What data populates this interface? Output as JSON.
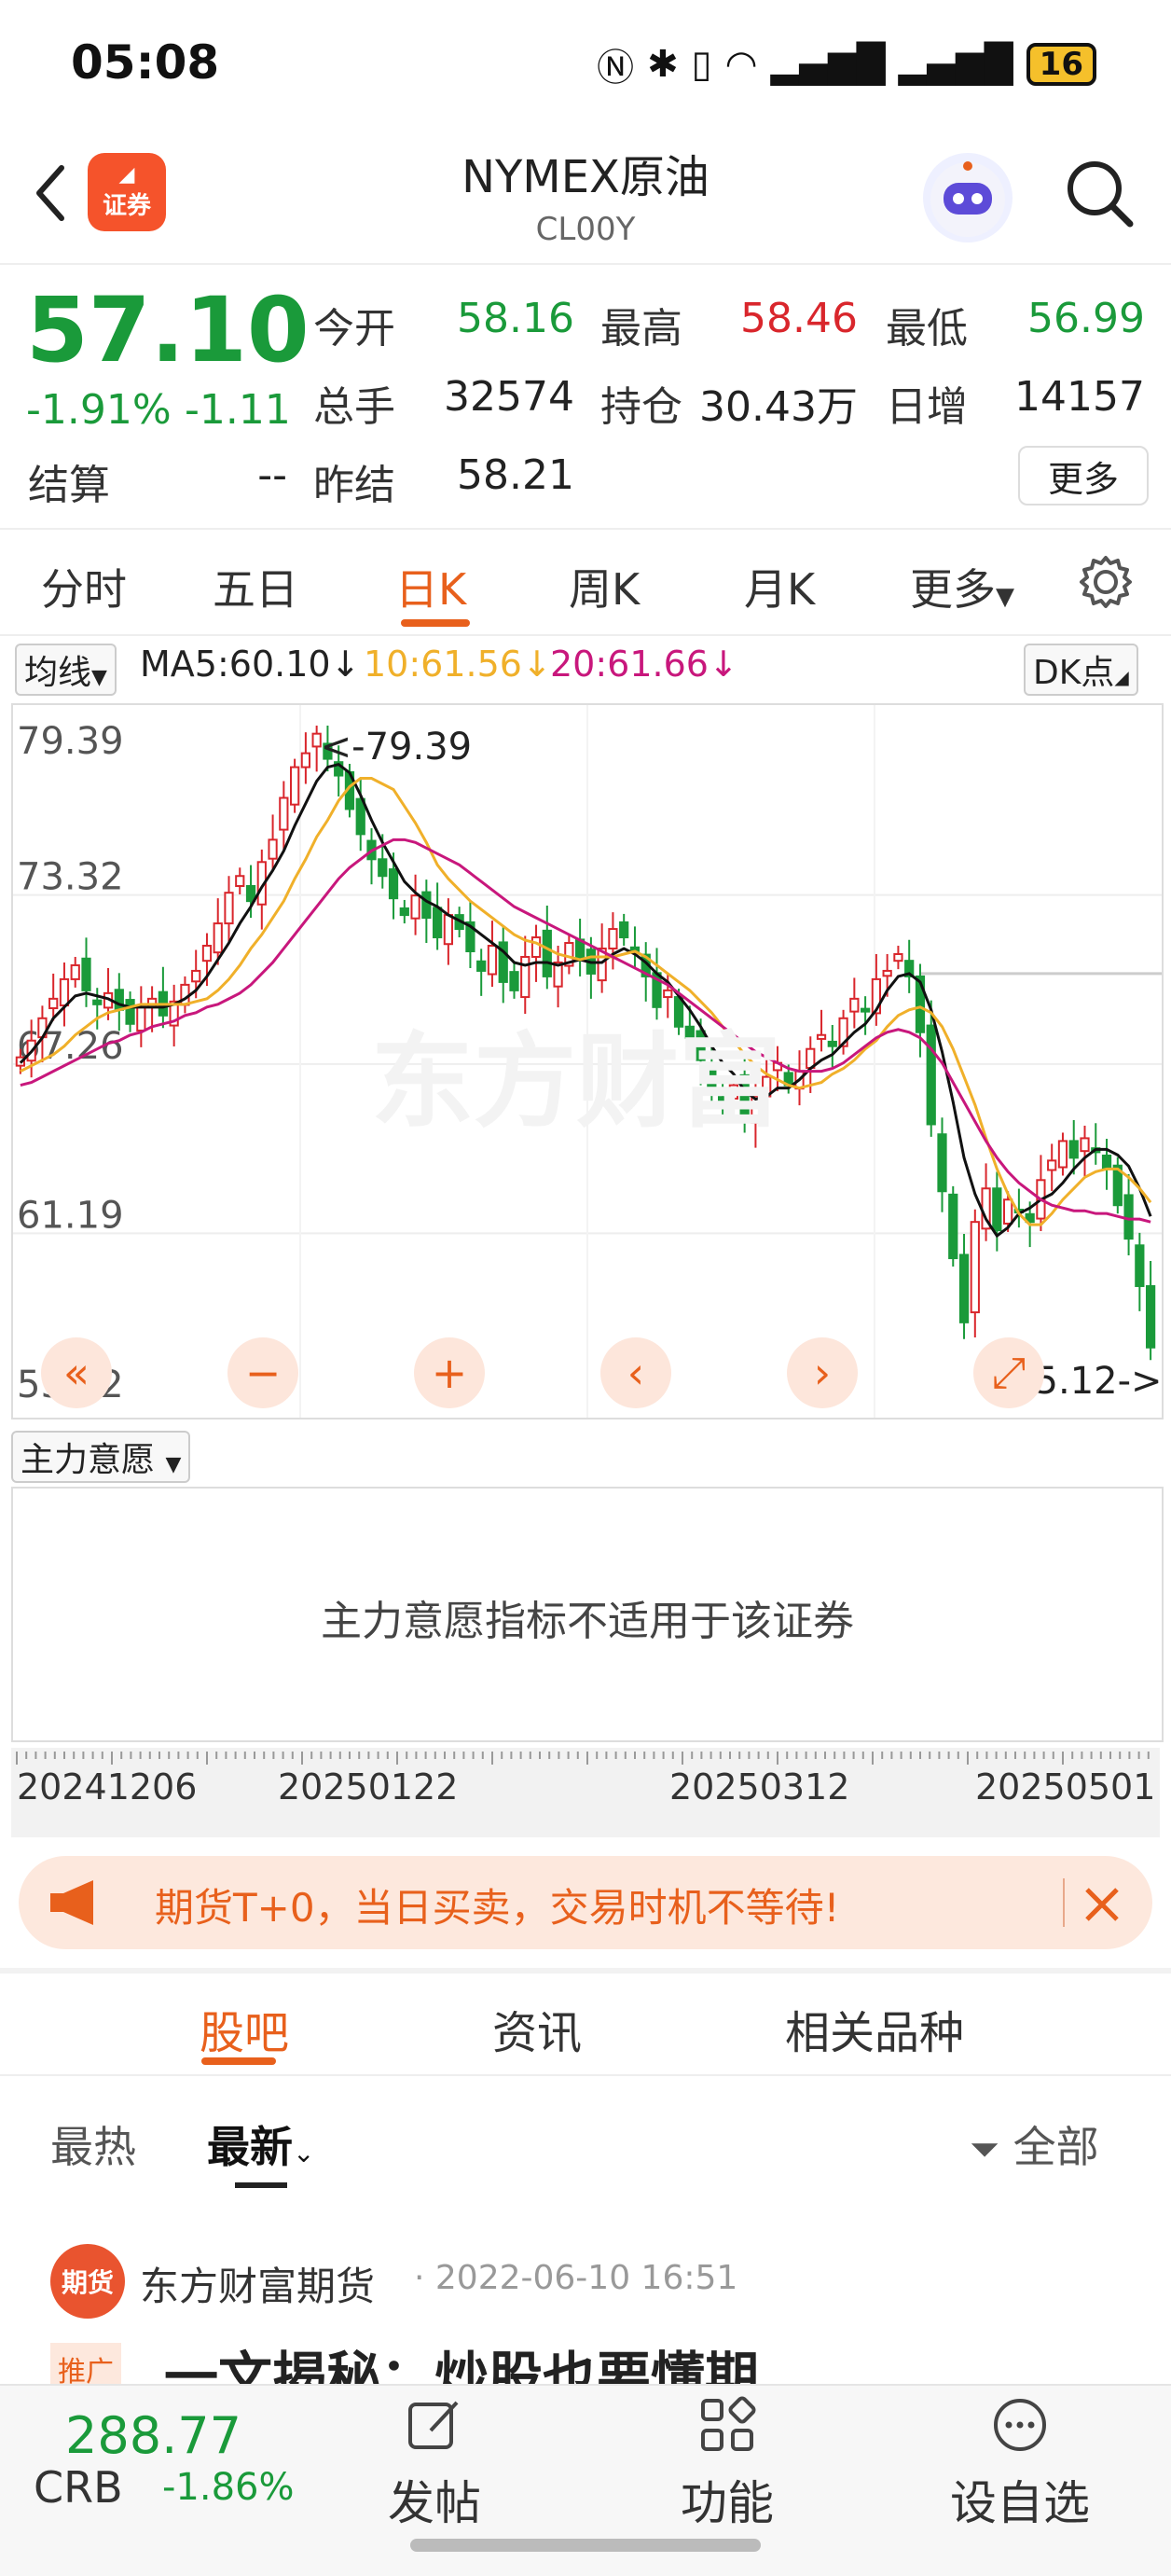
{
  "status": {
    "time": "05:08",
    "battery": "16"
  },
  "header": {
    "title": "NYMEX原油",
    "subtitle": "CL00Y",
    "logo_text": "证券"
  },
  "quote": {
    "price": "57.10",
    "change_pct": "-1.91%",
    "change_amt": "-1.11",
    "open_label": "今开",
    "open": "58.16",
    "high_label": "最高",
    "high": "58.46",
    "low_label": "最低",
    "low": "56.99",
    "volume_label": "总手",
    "volume": "32574",
    "oi_label": "持仓",
    "oi": "30.43万",
    "daily_inc_label": "日增",
    "daily_inc": "14157",
    "settle_label": "结算",
    "settle": "--",
    "prev_settle_label": "昨结",
    "prev_settle": "58.21",
    "more_label": "更多"
  },
  "tabs": [
    "分时",
    "五日",
    "日K",
    "周K",
    "月K",
    "更多"
  ],
  "ma": {
    "selector": "均线",
    "ma5": "MA5:60.10↓",
    "ma10": "10:61.56↓",
    "ma20": "20:61.66↓",
    "dk": "DK点"
  },
  "chart_data": {
    "type": "candlestick",
    "y_ticks": [
      "79.39",
      "73.32",
      "67.26",
      "61.19",
      "55.12"
    ],
    "ylim": [
      55.12,
      79.39
    ],
    "max_label": "<-79.39",
    "min_label": "55.12->",
    "x_ticks": [
      "20241206",
      "20250122",
      "20250312",
      "20250501"
    ],
    "close": [
      67.5,
      68.1,
      68.9,
      69.6,
      70.3,
      70.8,
      69.9,
      69.4,
      69.8,
      69.2,
      68.7,
      69.3,
      69.6,
      69.0,
      69.5,
      70.1,
      70.6,
      71.5,
      72.3,
      73.4,
      74.0,
      73.1,
      74.5,
      75.3,
      76.8,
      77.9,
      78.4,
      79.1,
      78.2,
      77.6,
      76.4,
      75.5,
      74.6,
      74.0,
      73.2,
      72.6,
      73.3,
      72.5,
      71.8,
      72.6,
      72.1,
      71.3,
      70.6,
      71.5,
      70.2,
      69.9,
      71.1,
      71.8,
      70.4,
      70.9,
      71.6,
      71.0,
      70.5,
      71.4,
      72.1,
      71.8,
      71.3,
      70.4,
      69.3,
      69.9,
      68.6,
      68.2,
      67.4,
      66.2,
      65.9,
      66.5,
      65.4,
      66.1,
      66.8,
      67.3,
      66.5,
      67.0,
      67.8,
      68.3,
      67.9,
      68.9,
      69.6,
      69.2,
      70.3,
      70.6,
      71.2,
      70.4,
      68.4,
      65.1,
      62.7,
      60.3,
      58.0,
      61.6,
      62.8,
      61.3,
      62.4,
      62.0,
      61.6,
      63.1,
      63.8,
      64.5,
      63.9,
      64.6,
      64.1,
      63.5,
      62.2,
      61.0,
      59.3,
      57.1
    ],
    "ma5": [
      67.3,
      67.7,
      68.2,
      68.9,
      69.3,
      69.7,
      69.8,
      69.7,
      69.6,
      69.4,
      69.3,
      69.3,
      69.3,
      69.3,
      69.4,
      69.6,
      69.9,
      70.4,
      71.0,
      71.6,
      72.3,
      72.9,
      73.6,
      74.2,
      74.9,
      75.8,
      76.6,
      77.4,
      77.9,
      78.0,
      77.7,
      76.9,
      76.0,
      75.2,
      74.5,
      73.8,
      73.4,
      73.1,
      72.9,
      72.6,
      72.4,
      72.2,
      71.9,
      71.6,
      71.3,
      70.9,
      70.8,
      70.9,
      70.9,
      70.8,
      70.9,
      71.0,
      70.9,
      70.9,
      71.2,
      71.4,
      71.2,
      70.9,
      70.5,
      70.2,
      69.7,
      69.2,
      68.6,
      67.9,
      67.3,
      66.9,
      66.3,
      66.0,
      66.1,
      66.4,
      66.4,
      66.7,
      67.1,
      67.4,
      67.6,
      68.0,
      68.4,
      68.7,
      69.2,
      69.9,
      70.4,
      70.5,
      70.2,
      69.2,
      67.7,
      65.9,
      63.9,
      62.6,
      61.7,
      61.1,
      61.4,
      61.9,
      62.1,
      62.4,
      62.6,
      63.0,
      63.5,
      63.9,
      64.2,
      64.2,
      64.0,
      63.6,
      62.8,
      61.8
    ],
    "ma10": [
      67.0,
      67.2,
      67.4,
      67.6,
      67.9,
      68.3,
      68.6,
      68.9,
      69.1,
      69.2,
      69.3,
      69.4,
      69.4,
      69.4,
      69.4,
      69.4,
      69.5,
      69.6,
      69.9,
      70.3,
      70.8,
      71.4,
      71.9,
      72.5,
      73.1,
      73.9,
      74.6,
      75.4,
      76.0,
      76.7,
      77.2,
      77.5,
      77.5,
      77.3,
      77.1,
      76.5,
      75.9,
      75.2,
      74.4,
      73.9,
      73.5,
      73.1,
      72.8,
      72.5,
      72.2,
      71.9,
      71.7,
      71.6,
      71.4,
      71.2,
      71.1,
      71.0,
      71.1,
      71.1,
      71.1,
      71.2,
      71.3,
      71.1,
      70.8,
      70.5,
      70.2,
      69.9,
      69.5,
      69.1,
      68.6,
      68.1,
      67.6,
      67.2,
      66.9,
      66.7,
      66.5,
      66.4,
      66.5,
      66.6,
      66.9,
      67.1,
      67.4,
      67.8,
      68.1,
      68.6,
      69.0,
      69.2,
      69.3,
      69.1,
      68.6,
      67.8,
      66.8,
      65.8,
      64.6,
      63.5,
      62.6,
      61.9,
      61.5,
      61.5,
      61.9,
      62.4,
      62.8,
      63.2,
      63.4,
      63.5,
      63.5,
      63.2,
      62.8,
      62.3
    ],
    "ma20": [
      66.5,
      66.6,
      66.8,
      67.0,
      67.2,
      67.4,
      67.6,
      67.8,
      68.0,
      68.1,
      68.3,
      68.4,
      68.6,
      68.7,
      68.8,
      69.0,
      69.1,
      69.3,
      69.4,
      69.6,
      69.8,
      70.1,
      70.5,
      70.9,
      71.4,
      71.9,
      72.4,
      72.9,
      73.4,
      73.9,
      74.3,
      74.6,
      74.9,
      75.1,
      75.3,
      75.3,
      75.2,
      75.0,
      74.8,
      74.6,
      74.4,
      74.1,
      73.8,
      73.5,
      73.2,
      72.9,
      72.7,
      72.5,
      72.3,
      72.1,
      71.9,
      71.7,
      71.5,
      71.3,
      71.1,
      70.9,
      70.7,
      70.5,
      70.3,
      70.1,
      69.8,
      69.5,
      69.2,
      68.9,
      68.6,
      68.3,
      68.0,
      67.7,
      67.5,
      67.3,
      67.1,
      67.0,
      67.0,
      67.0,
      67.1,
      67.3,
      67.6,
      67.9,
      68.2,
      68.4,
      68.5,
      68.4,
      68.2,
      67.8,
      67.3,
      66.6,
      65.9,
      65.2,
      64.5,
      63.9,
      63.4,
      63.0,
      62.7,
      62.4,
      62.2,
      62.1,
      62.0,
      62.0,
      61.9,
      61.9,
      61.8,
      61.7,
      61.7,
      61.6
    ]
  },
  "indicator": {
    "selector": "主力意愿",
    "message": "主力意愿指标不适用于该证券"
  },
  "banner": {
    "text": "期货T+0，当日买卖，交易时机不等待!"
  },
  "section_tabs": [
    "股吧",
    "资讯",
    "相关品种"
  ],
  "feed": {
    "hot": "最热",
    "new": "最新",
    "filter": "全部"
  },
  "post": {
    "avatar_text": "期货",
    "author": "东方财富期货",
    "meta": "· 2022-06-10 16:51",
    "tag": "推广",
    "title": "一文揭秘：炒股也要懂期"
  },
  "bottom": {
    "index_value": "288.77",
    "index_name": "CRB",
    "index_change": "-1.86%",
    "post_label": "发帖",
    "func_label": "功能",
    "watch_label": "设自选"
  },
  "colors": {
    "up": "#d9262c",
    "down": "#1a9a3a",
    "accent": "#e8601c",
    "ma5": "#111111",
    "ma10": "#f0b02a",
    "ma20": "#c8177c"
  }
}
